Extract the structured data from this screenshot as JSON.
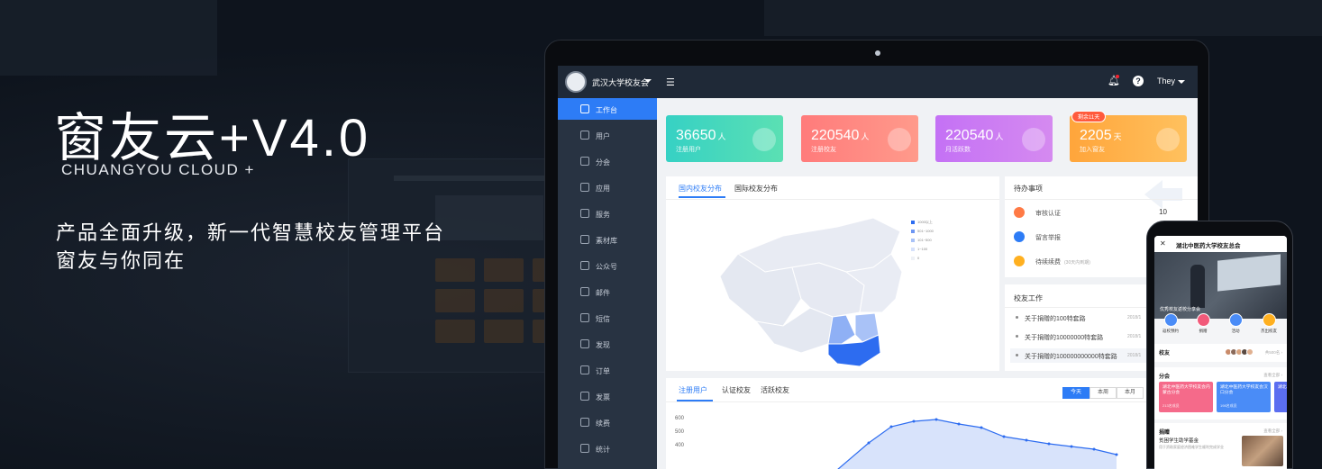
{
  "hero": {
    "title": "窗友云+V4.0",
    "subtitle": "CHUANGYOU CLOUD +",
    "line1": "产品全面升级，新一代智慧校友管理平台",
    "line2": "窗友与你同在"
  },
  "app": {
    "org_name": "武汉大学校友会",
    "user_name": "They",
    "sidebar": [
      {
        "label": "工作台",
        "icon": "desktop-icon",
        "active": true
      },
      {
        "label": "用户",
        "icon": "user-icon"
      },
      {
        "label": "分会",
        "icon": "layers-icon"
      },
      {
        "label": "应用",
        "icon": "box-icon"
      },
      {
        "label": "服务",
        "icon": "grid-icon"
      },
      {
        "label": "素材库",
        "icon": "folder-icon"
      },
      {
        "label": "公众号",
        "icon": "wechat-icon"
      },
      {
        "label": "邮件",
        "icon": "mail-icon"
      },
      {
        "label": "短信",
        "icon": "message-icon"
      },
      {
        "label": "发现",
        "icon": "camera-icon"
      },
      {
        "label": "订单",
        "icon": "file-icon"
      },
      {
        "label": "发票",
        "icon": "invoice-icon"
      },
      {
        "label": "续费",
        "icon": "renew-icon"
      },
      {
        "label": "统计",
        "icon": "bar-chart-icon"
      }
    ],
    "stats": [
      {
        "value": "36650",
        "unit": "人",
        "label": "注册用户",
        "color_from": "#36d1c4",
        "color_to": "#5be0b3"
      },
      {
        "value": "220540",
        "unit": "人",
        "label": "注册校友",
        "color_from": "#ff7b7b",
        "color_to": "#ff9a8b"
      },
      {
        "value": "220540",
        "unit": "人",
        "label": "月活跃数",
        "color_from": "#c471f5",
        "color_to": "#d58af0"
      },
      {
        "value": "2205",
        "unit": "天",
        "label": "加入窗友",
        "color_from": "#ffa53b",
        "color_to": "#ffc15e"
      }
    ],
    "stat_badge": "剩余11天",
    "map_panel": {
      "tabs": [
        "国内校友分布",
        "国际校友分布"
      ],
      "legend": [
        "1000以上",
        "501~1000",
        "101~500",
        "1~100",
        "0"
      ]
    },
    "todo": {
      "title": "待办事项",
      "items": [
        {
          "label": "审核认证",
          "count": "10",
          "color": "#ff7a45",
          "icon": "id-card-icon"
        },
        {
          "label": "留言举报",
          "count": "",
          "color": "#2d7cf6",
          "icon": "warning-icon"
        },
        {
          "label": "待续续费",
          "note": "(30天内到期)",
          "count": "",
          "color": "#ffb020",
          "icon": "lock-icon"
        }
      ]
    },
    "work": {
      "title": "校友工作",
      "items": [
        {
          "text": "关于捐赠的100特套路",
          "date": "2018/1"
        },
        {
          "text": "关于捐赠的10000000特套路",
          "date": "2018/1"
        },
        {
          "text": "关于捐赠的100000000000特套路",
          "date": "2018/1"
        }
      ]
    },
    "chart_panel": {
      "tabs": [
        "注册用户",
        "认证校友",
        "活跃校友"
      ],
      "periods": [
        "今天",
        "本周",
        "本月"
      ],
      "yticks": [
        "600",
        "500",
        "400"
      ]
    }
  },
  "phone": {
    "title": "湖北中医药大学校友总会",
    "banner_caption": "优秀校友返校分享会",
    "quick": [
      {
        "label": "返校预约",
        "color": "#4a8cf7"
      },
      {
        "label": "捐赠",
        "color": "#f25a7a"
      },
      {
        "label": "活动",
        "color": "#4a8cf7"
      },
      {
        "label": "杰出校友",
        "color": "#ffb020"
      }
    ],
    "alumni_title": "校友",
    "alumni_more": "共500名 ›",
    "branch_title": "分会",
    "branch_more": "查看全部 ›",
    "branches": [
      {
        "text": "湖北中医药大学校友会内蒙古分会",
        "sub": "213名成员",
        "color": "#f56a8a"
      },
      {
        "text": "湖北中医药大学校友会汉口分会",
        "sub": "198名成员",
        "color": "#4a8cf7"
      },
      {
        "text": "湖北校友会",
        "sub": "",
        "color": "#5b6ef0"
      }
    ],
    "donation_title": "捐赠",
    "donation_more": "查看全部 ›",
    "donation_item": "贫困学生助学基金",
    "donation_desc": "用于资助家庭经济困难学生顺利完成学业"
  }
}
